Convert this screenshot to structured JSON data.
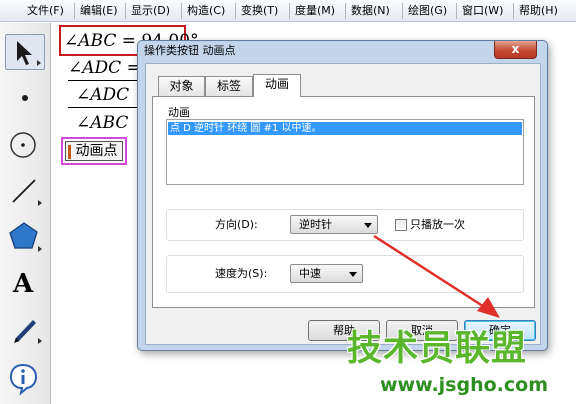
{
  "menubar": {
    "items": [
      "文件(F)",
      "编辑(E)",
      "显示(D)",
      "构造(C)",
      "变换(T)",
      "度量(M)",
      "数据(N)",
      "绘图(G)",
      "窗口(W)",
      "帮助(H)"
    ]
  },
  "toolbox": {
    "tools": [
      "arrow-select",
      "point",
      "compass",
      "straightedge",
      "polygon",
      "text",
      "marker",
      "information"
    ],
    "text_tool_glyph": "A"
  },
  "canvas": {
    "measurements": [
      {
        "angle": "∠",
        "label": "ABC",
        "value": "= 94.00°"
      },
      {
        "angle": "∠",
        "label": "ADC",
        "value": "="
      },
      {
        "angle": "∠",
        "label": "ADC",
        "value": ""
      },
      {
        "angle": "∠",
        "label": "ABC",
        "value": ""
      }
    ],
    "action_button_label": "动画点"
  },
  "dialog": {
    "title": "操作类按钮 动画点",
    "close_glyph": "x",
    "tabs": [
      {
        "label": "对象",
        "active": false
      },
      {
        "label": "标签",
        "active": false
      },
      {
        "label": "动画",
        "active": true
      }
    ],
    "animation_section_label": "动画",
    "animation_list": [
      "点 D 逆时针 环绕 圆 #1 以中速。"
    ],
    "direction": {
      "label": "方向(D):",
      "value": "逆时针"
    },
    "play_once": {
      "label": "只播放一次",
      "checked": false
    },
    "speed": {
      "label": "速度为(S):",
      "value": "中速"
    },
    "buttons": {
      "help": "帮助",
      "cancel": "取消",
      "ok": "确定"
    }
  },
  "watermark": {
    "title": "技术员联盟",
    "url": "www.jsgho.com"
  },
  "colors": {
    "highlight_box": "#c8191e",
    "button_highlight": "#d04ad6",
    "selection": "#3399ff",
    "arrow": "#e0302a",
    "watermark": "#5ab62a"
  }
}
